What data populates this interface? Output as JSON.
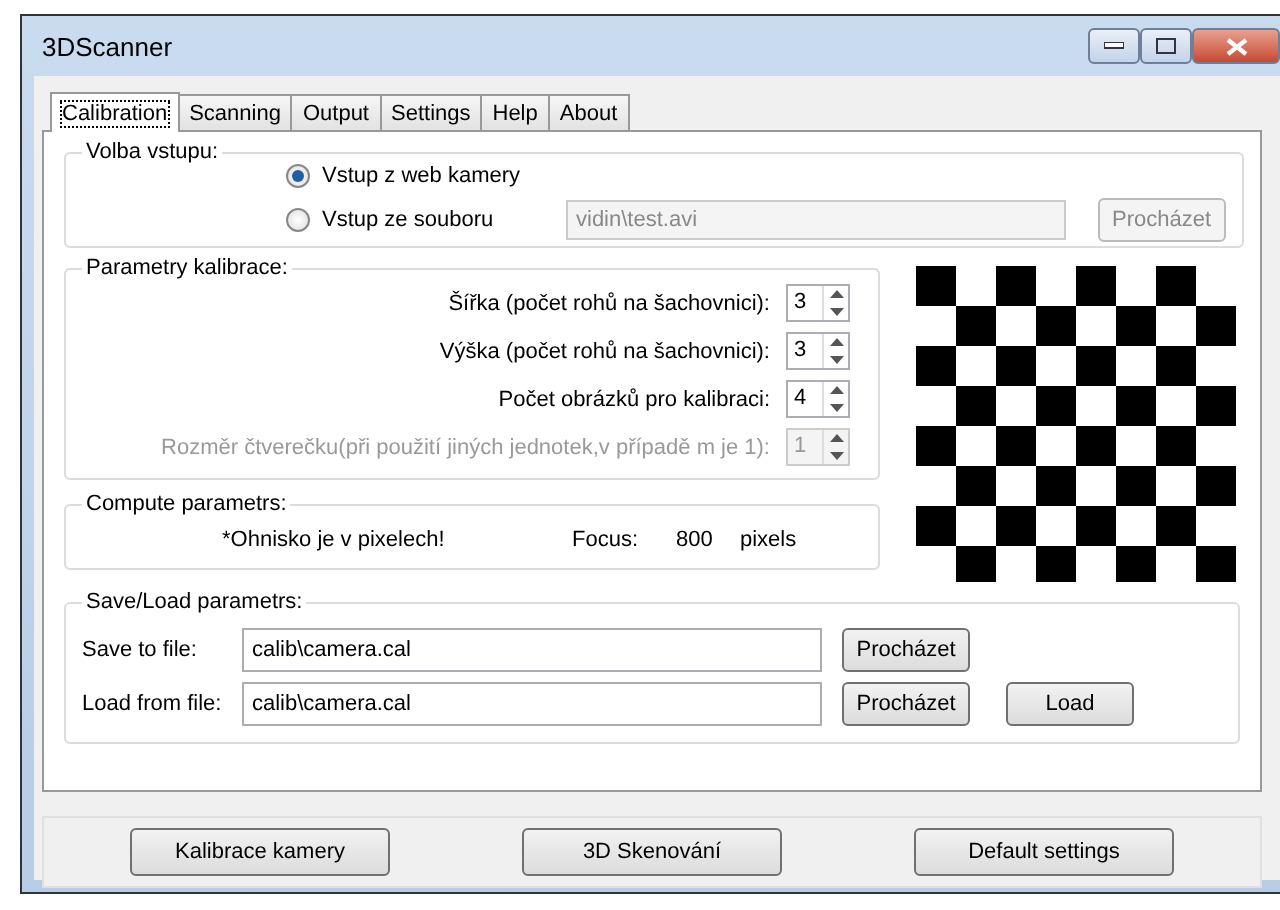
{
  "window": {
    "title": "3DScanner"
  },
  "tabs": [
    {
      "label": "Calibration",
      "selected": true
    },
    {
      "label": "Scanning",
      "selected": false
    },
    {
      "label": "Output",
      "selected": false
    },
    {
      "label": "Settings",
      "selected": false
    },
    {
      "label": "Help",
      "selected": false
    },
    {
      "label": "About",
      "selected": false
    }
  ],
  "input_source": {
    "title": "Volba vstupu:",
    "options": [
      {
        "label": "Vstup z web kamery",
        "selected": true
      },
      {
        "label": "Vstup ze souboru",
        "selected": false
      }
    ],
    "file_field": {
      "value": "vidin\\test.avi",
      "disabled": true
    },
    "browse_button": {
      "label": "Procházet",
      "disabled": true
    }
  },
  "calibration": {
    "title": "Parametry kalibrace:",
    "params": [
      {
        "label": "Šířka (počet rohů na šachovnici):",
        "value": "3",
        "disabled": false
      },
      {
        "label": "Výška (počet rohů na šachovnici):",
        "value": "3",
        "disabled": false
      },
      {
        "label": "Počet obrázků pro kalibraci:",
        "value": "4",
        "disabled": false
      },
      {
        "label": "Rozměr čtverečku(při použití jiných jednotek,v případě m je 1):",
        "value": "1",
        "disabled": true
      }
    ]
  },
  "compute": {
    "title": "Compute parametrs:",
    "note": "*Ohnisko je v pixelech!",
    "focus_label": "Focus:",
    "focus_value": "800",
    "focus_unit": "pixels"
  },
  "save_load": {
    "title": "Save/Load parametrs:",
    "rows": [
      {
        "label": "Save to file:",
        "value": "calib\\camera.cal",
        "browse": "Procházet"
      },
      {
        "label": "Load from file:",
        "value": "calib\\camera.cal",
        "browse": "Procházet",
        "action": "Load"
      }
    ]
  },
  "footer_buttons": [
    "Kalibrace kamery",
    "3D Skenování",
    "Default settings"
  ]
}
